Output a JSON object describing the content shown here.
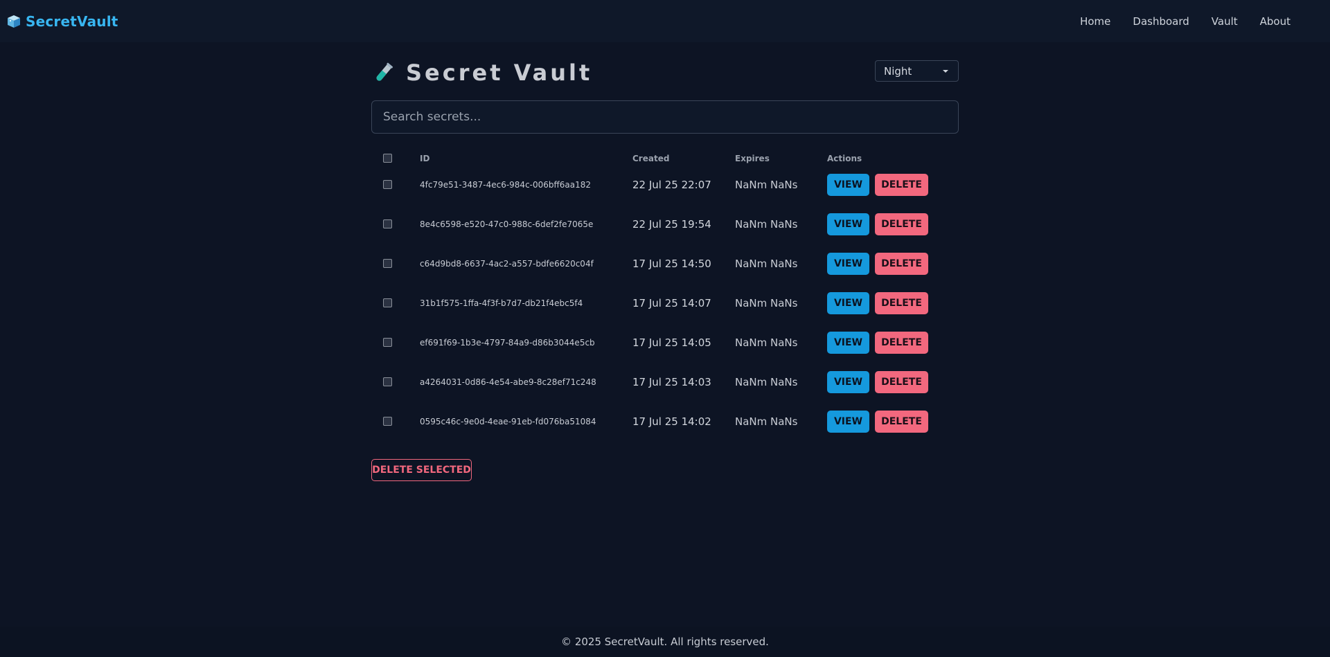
{
  "nav": {
    "brand": "SecretVault",
    "links": [
      "Home",
      "Dashboard",
      "Vault",
      "About"
    ]
  },
  "page": {
    "title": "Secret Vault",
    "theme_selected": "Night",
    "search_placeholder": "Search secrets..."
  },
  "table": {
    "headers": {
      "id": "ID",
      "created": "Created",
      "expires": "Expires",
      "actions": "Actions"
    },
    "view_label": "VIEW",
    "delete_label": "DELETE",
    "rows": [
      {
        "id": "4fc79e51-3487-4ec6-984c-006bff6aa182",
        "created": "22 Jul 25 22:07",
        "expires": "NaNm NaNs"
      },
      {
        "id": "8e4c6598-e520-47c0-988c-6def2fe7065e",
        "created": "22 Jul 25 19:54",
        "expires": "NaNm NaNs"
      },
      {
        "id": "c64d9bd8-6637-4ac2-a557-bdfe6620c04f",
        "created": "17 Jul 25 14:50",
        "expires": "NaNm NaNs"
      },
      {
        "id": "31b1f575-1ffa-4f3f-b7d7-db21f4ebc5f4",
        "created": "17 Jul 25 14:07",
        "expires": "NaNm NaNs"
      },
      {
        "id": "ef691f69-1b3e-4797-84a9-d86b3044e5cb",
        "created": "17 Jul 25 14:05",
        "expires": "NaNm NaNs"
      },
      {
        "id": "a4264031-0d86-4e54-abe9-8c28ef71c248",
        "created": "17 Jul 25 14:03",
        "expires": "NaNm NaNs"
      },
      {
        "id": "0595c46c-9e0d-4eae-91eb-fd076ba51084",
        "created": "17 Jul 25 14:02",
        "expires": "NaNm NaNs"
      }
    ]
  },
  "bulk": {
    "delete_selected_label": "DELETE SELECTED"
  },
  "footer": {
    "text": "© 2025 SecretVault. All rights reserved."
  },
  "colors": {
    "background": "#0d1424",
    "accent": "#38b6f1",
    "view_button": "#1599dd",
    "delete_button": "#f2687e"
  },
  "icons": {
    "brand": "ice-cube-icon",
    "title": "test-tube-icon"
  }
}
